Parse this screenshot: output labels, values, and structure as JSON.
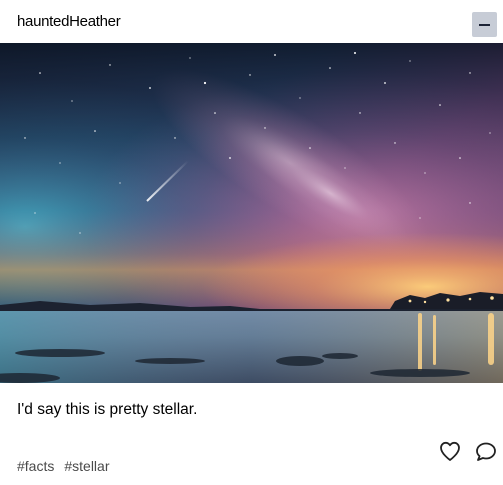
{
  "post": {
    "username": "hauntedHeather",
    "collapse_icon": "minus-icon",
    "image_subject": "Milky Way over water at night",
    "caption": "I'd say this is pretty stellar.",
    "tags": [
      "#facts",
      "#stellar"
    ],
    "actions": {
      "like_icon": "heart-icon",
      "comment_icon": "speech-bubble-icon"
    }
  },
  "colors": {
    "collapse_button_bg": "#c7ccd6",
    "collapse_button_fg": "#1b2235",
    "tag_text": "#4a4a4a",
    "icon_stroke": "#222222"
  }
}
